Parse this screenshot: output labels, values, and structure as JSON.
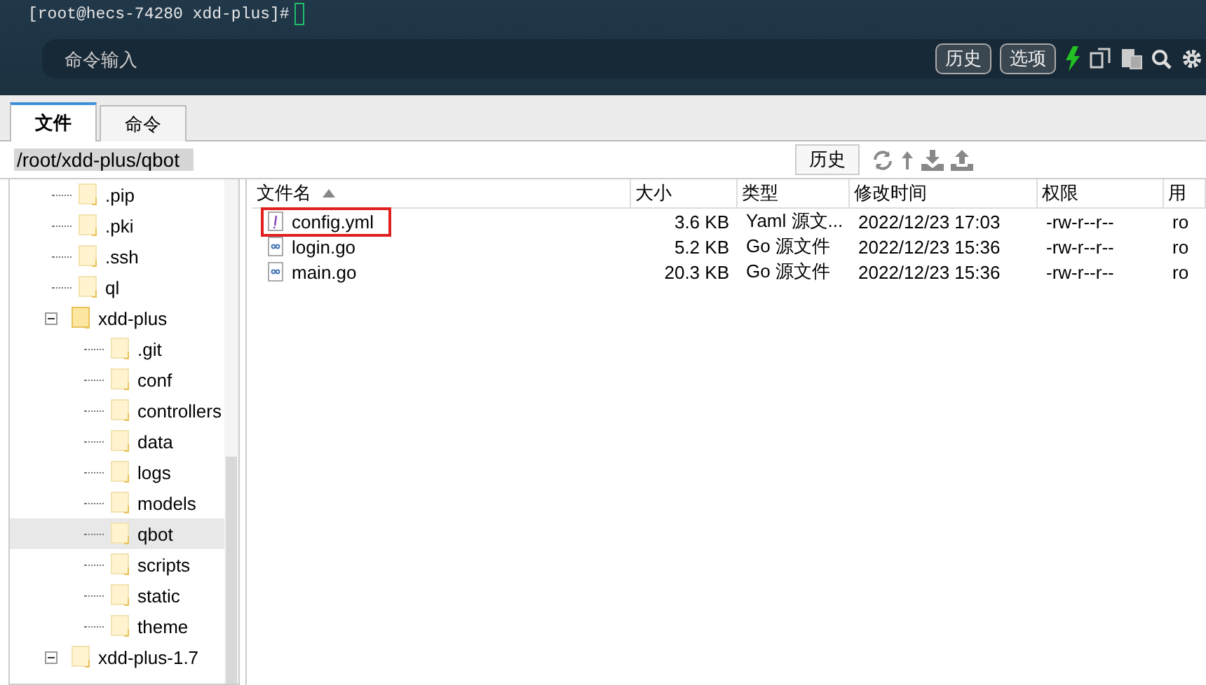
{
  "terminal": {
    "prompt": "[root@hecs-74280 xdd-plus]#"
  },
  "command_bar": {
    "placeholder": "命令输入",
    "buttons": [
      "历史",
      "选项"
    ]
  },
  "tabs": [
    {
      "label": "文件",
      "selected": true
    },
    {
      "label": "命令",
      "selected": false
    }
  ],
  "path_bar": {
    "value": "/root/xdd-plus/qbot",
    "history_button": "历史"
  },
  "tree": [
    {
      "name": ".pip",
      "selected": false
    },
    {
      "name": ".pki",
      "selected": false
    },
    {
      "name": ".ssh",
      "selected": false
    },
    {
      "name": "ql",
      "selected": false
    },
    {
      "name": "xdd-plus",
      "selected": false,
      "expanded": true,
      "children": [
        {
          "name": ".git",
          "selected": false
        },
        {
          "name": "conf",
          "selected": false
        },
        {
          "name": "controllers",
          "selected": false
        },
        {
          "name": "data",
          "selected": false
        },
        {
          "name": "logs",
          "selected": false
        },
        {
          "name": "models",
          "selected": false
        },
        {
          "name": "qbot",
          "selected": true
        },
        {
          "name": "scripts",
          "selected": false
        },
        {
          "name": "static",
          "selected": false
        },
        {
          "name": "theme",
          "selected": false
        }
      ]
    },
    {
      "name": "xdd-plus-1.7",
      "selected": false,
      "expanded": true
    }
  ],
  "file_table": {
    "columns": [
      "文件名",
      "大小",
      "类型",
      "修改时间",
      "权限",
      "用"
    ],
    "rows": [
      {
        "kind": "yaml",
        "highlighted": true,
        "cells": [
          "config.yml",
          "3.6 KB",
          "Yaml 源文...",
          "2022/12/23 17:03",
          "-rw-r--r--",
          "ro"
        ]
      },
      {
        "kind": "go",
        "highlighted": false,
        "cells": [
          "login.go",
          "5.2 KB",
          "Go 源文件",
          "2022/12/23 15:36",
          "-rw-r--r--",
          "ro"
        ]
      },
      {
        "kind": "go",
        "highlighted": false,
        "cells": [
          "main.go",
          "20.3 KB",
          "Go 源文件",
          "2022/12/23 15:36",
          "-rw-r--r--",
          "ro"
        ]
      }
    ]
  }
}
